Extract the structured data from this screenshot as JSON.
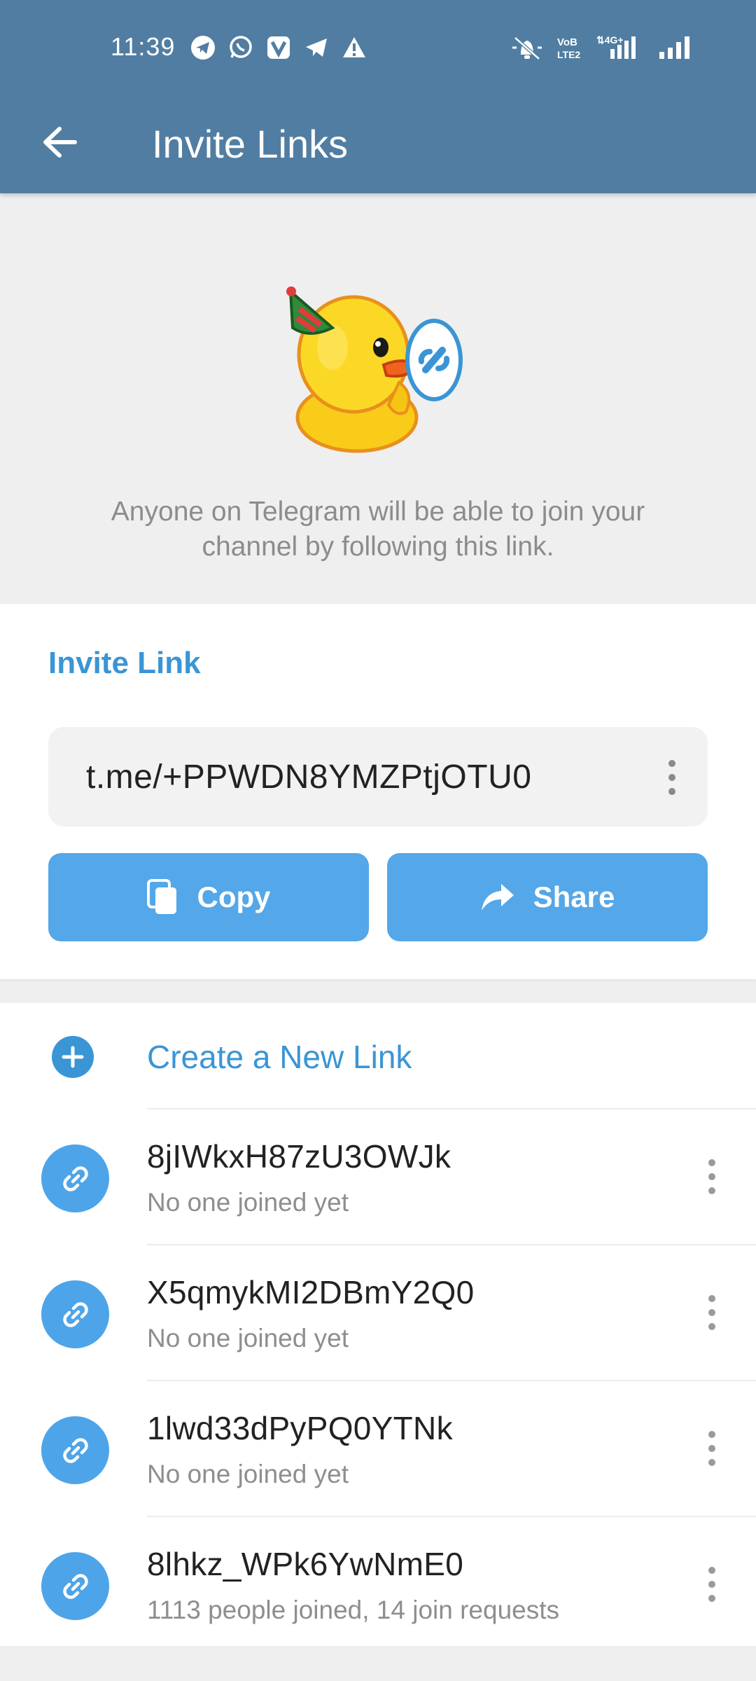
{
  "status_bar": {
    "time": "11:39",
    "left_icons": [
      "telegram-icon",
      "whatsapp-icon",
      "vivaldi-icon",
      "telegram-icon",
      "warning-icon"
    ],
    "right_icons": [
      "mute-icon",
      "volte-icon",
      "4g-signal-icon",
      "signal-icon"
    ],
    "network_labels": {
      "vo_lte": "VoB LTE2",
      "data": "4G+"
    }
  },
  "app_bar": {
    "back_icon": "arrow-left-icon",
    "title": "Invite Links"
  },
  "hero": {
    "illustration": "duck-party-sticker",
    "description": "Anyone on Telegram will be able to join your channel by following this link."
  },
  "invite_section": {
    "title": "Invite Link",
    "link": "t.me/+PPWDN8YMZPtjOTU0",
    "menu_icon": "more-vertical-icon",
    "copy_label": "Copy",
    "share_label": "Share"
  },
  "links_list": {
    "create_label": "Create a New Link",
    "items": [
      {
        "title": "8jIWkxH87zU3OWJk",
        "subtitle": "No one joined yet"
      },
      {
        "title": "X5qmykMI2DBmY2Q0",
        "subtitle": "No one joined yet"
      },
      {
        "title": "1lwd33dPyPQ0YTNk",
        "subtitle": "No one joined yet"
      },
      {
        "title": "8lhkz_WPk6YwNmE0",
        "subtitle": "1113 people joined, 14 join requests"
      }
    ]
  },
  "colors": {
    "header": "#517da2",
    "accent": "#3a95d5",
    "button": "#54a7e8"
  }
}
